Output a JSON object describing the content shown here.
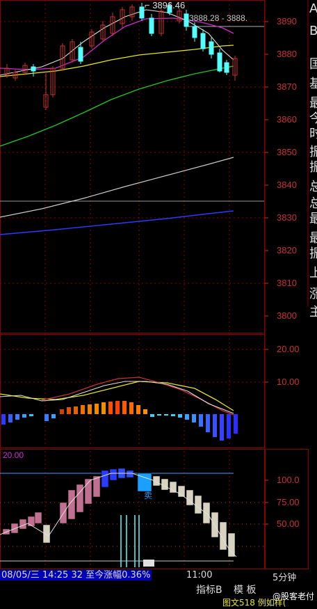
{
  "main_chart": {
    "price_high_label": "3896.46",
    "price_level_label": "3888.28 - 3888.",
    "y_axis": [
      "3890",
      "3880",
      "3870",
      "3860",
      "3850",
      "3840",
      "3830",
      "3820",
      "3810",
      "3800"
    ]
  },
  "macd_panel": {
    "y_axis": [
      "20.00",
      "10.00"
    ]
  },
  "kdj_panel": {
    "header_value": "20.00",
    "y_axis": [
      "100.0",
      "75.00",
      "50.00"
    ],
    "annotation": "卖"
  },
  "status_bar": {
    "date_text": "08/05/三",
    "info_text": "14:25 32 至今涨幅0.36%",
    "time_mark": "11:00",
    "tab_model": "模 板",
    "tab_interval": "5分钟",
    "tab_indicator": "指标B",
    "bottom_text": "图文518 例如样(",
    "watermark": "@股客老付"
  },
  "right_panel": {
    "chars": [
      "A",
      "B",
      "国",
      "基",
      "最",
      "今",
      "时",
      "振",
      "振",
      "总",
      "总",
      "最",
      "最",
      "振",
      "上",
      "涨",
      "主"
    ]
  },
  "colors": {
    "grid": "#8b0000",
    "up_candle": "#c83232",
    "down_candle": "#54ffff"
  }
}
